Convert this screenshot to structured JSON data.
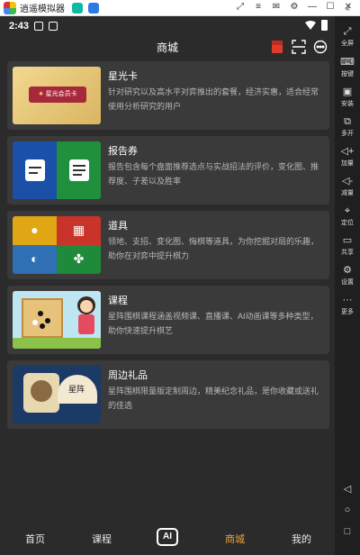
{
  "emulator": {
    "title": "逍遥模拟器",
    "window_controls": [
      "⤢",
      "≡",
      "✉",
      "⚙",
      "—",
      "☐",
      "✕"
    ],
    "side_collapse": "«",
    "sidebar": [
      {
        "icon": "fullscreen-icon",
        "glyph": "⤢",
        "label": "全屏"
      },
      {
        "icon": "keyboard-icon",
        "glyph": "⌨",
        "label": "按键"
      },
      {
        "icon": "apk-install-icon",
        "glyph": "▣",
        "label": "安装"
      },
      {
        "icon": "multi-instance-icon",
        "glyph": "⧉",
        "label": "多开"
      },
      {
        "icon": "volume-up-icon",
        "glyph": "◁+",
        "label": "加量"
      },
      {
        "icon": "volume-down-icon",
        "glyph": "◁-",
        "label": "减量"
      },
      {
        "icon": "location-icon",
        "glyph": "⌖",
        "label": "定位"
      },
      {
        "icon": "shared-folder-icon",
        "glyph": "▭",
        "label": "共享"
      },
      {
        "icon": "settings-icon",
        "glyph": "⚙",
        "label": "设置"
      },
      {
        "icon": "more-icon",
        "glyph": "···",
        "label": "更多"
      }
    ],
    "system_buttons": [
      {
        "icon": "back-icon",
        "glyph": "◁"
      },
      {
        "icon": "home-icon",
        "glyph": "○"
      },
      {
        "icon": "recents-icon",
        "glyph": "□"
      }
    ]
  },
  "status_bar": {
    "time": "2:43"
  },
  "header": {
    "title": "商城"
  },
  "cards": [
    {
      "title": "星光卡",
      "desc": "针对研究以及高水平对弈推出的套餐，经济实惠，适合经常使用分析研究的用户",
      "thumb_label": "星光会员卡"
    },
    {
      "title": "报告券",
      "desc": "报告包含每个盘面推荐选点与实战招法的评价，变化图、推荐度、子差以及胜率"
    },
    {
      "title": "道具",
      "desc": "领地、支招、变化图、悔棋等道具，为你挖掘对局的乐趣，助你在对弈中提升棋力"
    },
    {
      "title": "课程",
      "desc": "星阵围棋课程涵盖视频课、直播课、AI动画课等多种类型，助你快速提升棋艺"
    },
    {
      "title": "周边礼品",
      "desc": "星阵围棋限量版定制周边，精美纪念礼品，是你收藏或送礼的佳选",
      "thumb_label": "星阵"
    }
  ],
  "bottom_nav": {
    "home": "首页",
    "course": "课程",
    "ai": "AI",
    "mall": "商城",
    "mine": "我的"
  },
  "colors": {
    "accent": "#f0a23a",
    "background": "#2b2b2b",
    "card": "#3a3a3a"
  }
}
